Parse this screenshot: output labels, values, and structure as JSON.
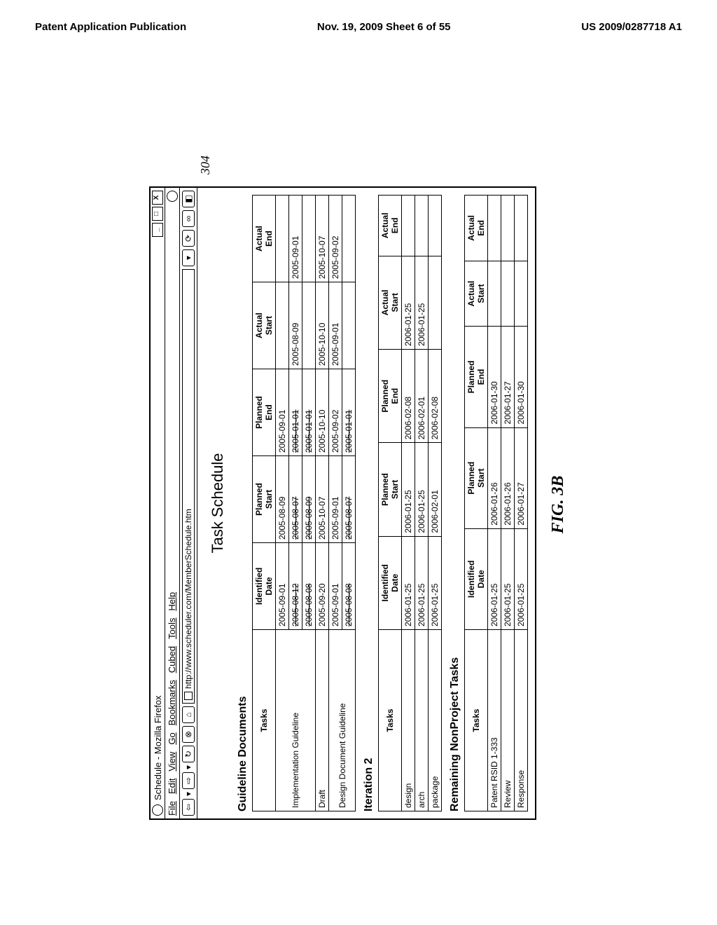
{
  "page_header": {
    "left": "Patent Application Publication",
    "center": "Nov. 19, 2009  Sheet 6 of 55",
    "right": "US 2009/0287718 A1"
  },
  "callout": "304",
  "window_title": "Schedule - Mozilla Firefox",
  "menubar": [
    "File",
    "Edit",
    "View",
    "Go",
    "Bookmarks",
    "Cubed",
    "Tools",
    "Help"
  ],
  "url": "http://www.scheduler.com/MemberSchedule.htm",
  "big_title": "Task Schedule",
  "sections": [
    {
      "title": "Guideline Documents",
      "headers": [
        "Tasks",
        "Identified Date",
        "Planned Start",
        "Planned End",
        "Actual Start",
        "Actual End"
      ],
      "rows": [
        {
          "task": "Implementation Guideline",
          "sub": [
            {
              "cells": [
                "2005-09-01",
                "2005-08-09",
                "2005-09-01",
                "",
                ""
              ],
              "strike": []
            },
            {
              "cells": [
                "2005-08-12",
                "2005-08-07",
                "2005-01-01",
                "2005-08-09",
                "2005-09-01"
              ],
              "strike": [
                0,
                1,
                2
              ]
            },
            {
              "cells": [
                "2005-08-08",
                "2005-08-09",
                "2005-01-01",
                "",
                ""
              ],
              "strike": [
                0,
                1,
                2
              ]
            }
          ]
        },
        {
          "task": "Draft",
          "sub": [
            {
              "cells": [
                "2005-09-20",
                "2005-10-07",
                "2005-10-10",
                "2005-10-10",
                "2005-10-07"
              ],
              "strike": []
            }
          ]
        },
        {
          "task": "Design Document Guideline",
          "sub": [
            {
              "cells": [
                "2005-09-01",
                "2005-09-01",
                "2005-09-02",
                "2005-09-01",
                "2005-09-02"
              ],
              "strike": []
            },
            {
              "cells": [
                "2005-08-08",
                "2005-08-07",
                "2005-01-01",
                "",
                ""
              ],
              "strike": [
                0,
                1,
                2
              ]
            }
          ]
        }
      ]
    },
    {
      "title": "Iteration 2",
      "headers": [
        "Tasks",
        "Identified Date",
        "Planned Start",
        "Planned End",
        "Actual Start",
        "Actual End"
      ],
      "rows": [
        {
          "task": "design",
          "sub": [
            {
              "cells": [
                "2006-01-25",
                "2006-01-25",
                "2006-02-08",
                "2006-01-25",
                ""
              ],
              "strike": []
            }
          ]
        },
        {
          "task": "arch",
          "sub": [
            {
              "cells": [
                "2006-01-25",
                "2006-01-25",
                "2006-02-01",
                "2006-01-25",
                ""
              ],
              "strike": []
            }
          ]
        },
        {
          "task": "package",
          "sub": [
            {
              "cells": [
                "2006-01-25",
                "2006-02-01",
                "2006-02-08",
                "",
                ""
              ],
              "strike": []
            }
          ]
        }
      ]
    },
    {
      "title": "Remaining NonProject Tasks",
      "headers": [
        "Tasks",
        "Identified Date",
        "Planned Start",
        "Planned End",
        "Actual Start",
        "Actual End"
      ],
      "rows": [
        {
          "task": "Patent RSID 1-333",
          "sub": [
            {
              "cells": [
                "2006-01-25",
                "2006-01-26",
                "2006-01-30",
                "",
                ""
              ],
              "strike": []
            }
          ]
        },
        {
          "task": "Review",
          "sub": [
            {
              "cells": [
                "2006-01-25",
                "2006-01-26",
                "2006-01-27",
                "",
                ""
              ],
              "strike": []
            }
          ]
        },
        {
          "task": "Response",
          "sub": [
            {
              "cells": [
                "2006-01-25",
                "2006-01-27",
                "2006-01-30",
                "",
                ""
              ],
              "strike": []
            }
          ]
        }
      ]
    }
  ],
  "figure_label": "FIG. 3B"
}
